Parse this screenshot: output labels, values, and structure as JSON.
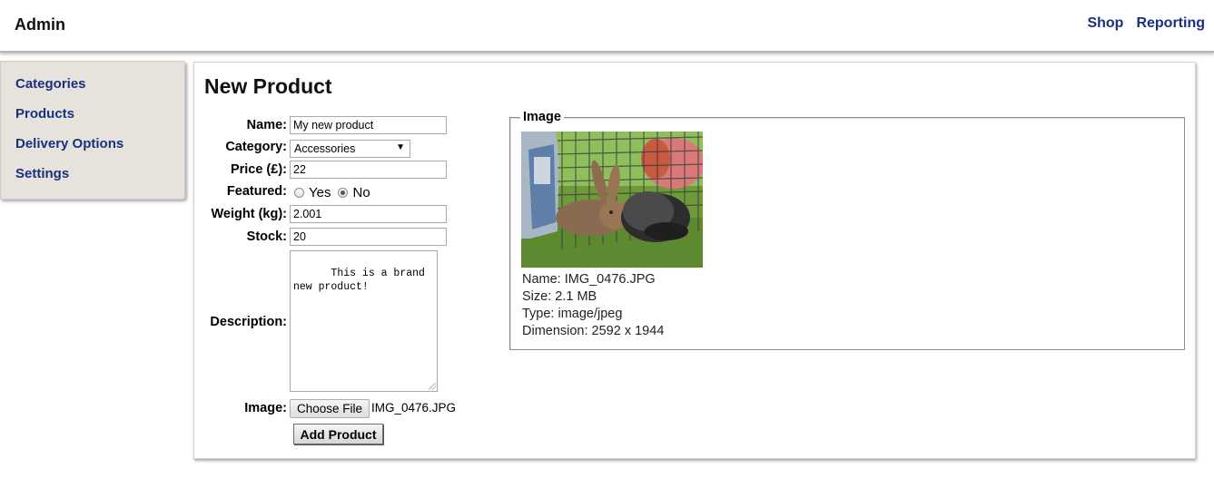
{
  "header": {
    "brand": "Admin",
    "nav": [
      "Shop",
      "Reporting"
    ]
  },
  "sidebar": {
    "items": [
      {
        "label": "Categories"
      },
      {
        "label": "Products"
      },
      {
        "label": "Delivery Options"
      },
      {
        "label": "Settings"
      }
    ]
  },
  "main": {
    "title": "New Product",
    "form": {
      "name_label": "Name:",
      "name_value": "My new product",
      "category_label": "Category:",
      "category_value": "Accessories",
      "price_label": "Price (£):",
      "price_value": "22",
      "featured_label": "Featured:",
      "featured_yes": "Yes",
      "featured_no": "No",
      "featured_selected": "No",
      "weight_label": "Weight (kg):",
      "weight_value": "2.001",
      "stock_label": "Stock:",
      "stock_value": "20",
      "description_label": "Description:",
      "description_value": "This is a brand new product!",
      "image_label": "Image:",
      "choose_file_label": "Choose File",
      "chosen_file": "IMG_0476.JPG",
      "submit_label": "Add Product"
    },
    "image_panel": {
      "legend": "Image",
      "info": [
        "Name: IMG_0476.JPG",
        "Size: 2.1 MB",
        "Type: image/jpeg",
        "Dimension: 2592 x 1944"
      ]
    }
  },
  "colors": {
    "link": "#1b2f80",
    "sidebar_bg": "#e5e3dc"
  }
}
